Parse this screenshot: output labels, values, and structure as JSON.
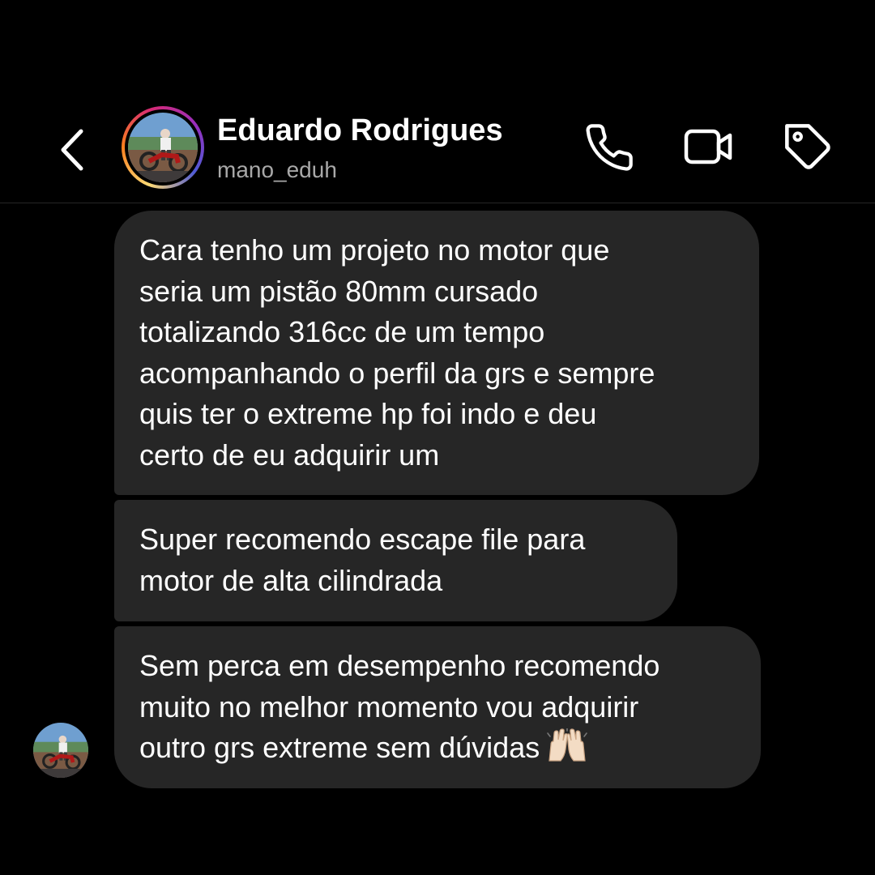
{
  "header": {
    "name": "Eduardo Rodrigues",
    "username": "mano_eduh"
  },
  "icons": {
    "back": "chevron-left-icon",
    "call": "phone-icon",
    "video": "video-camera-icon",
    "tag": "tag-icon"
  },
  "colors": {
    "background": "#000000",
    "bubble": "#262626",
    "text": "#ffffff",
    "secondary_text": "#a8a8a8"
  },
  "messages": [
    {
      "lines": [
        "Cara tenho um projeto no motor que",
        "seria um pistão 80mm cursado",
        "totalizando 316cc de um tempo",
        "acompanhando o perfil da grs e sempre",
        "quis ter o extreme hp foi indo e deu",
        "certo de eu adquirir um"
      ]
    },
    {
      "lines": [
        "Super recomendo escape file para",
        "motor de alta cilindrada"
      ]
    },
    {
      "lines": [
        "Sem perca em desempenho recomendo",
        "muito no melhor momento vou adquirir",
        "outro grs extreme sem dúvidas"
      ],
      "emoji": "raising-hands-emoji"
    }
  ]
}
